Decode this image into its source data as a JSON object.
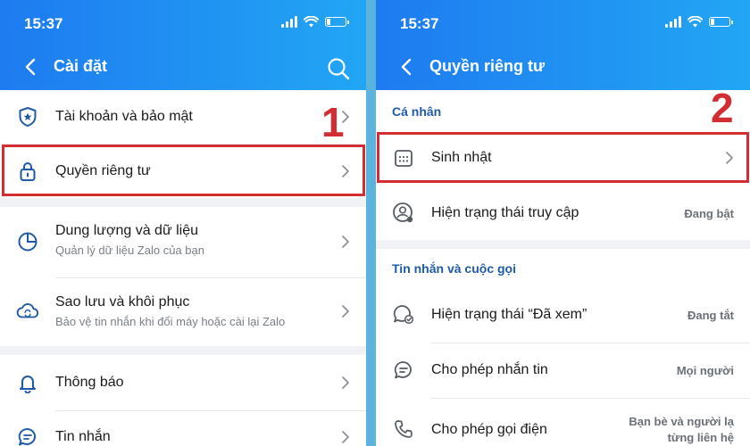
{
  "left": {
    "status": {
      "time": "15:37"
    },
    "header": {
      "title": "Cài đặt"
    },
    "items": [
      {
        "label": "Tài khoản và bảo mật"
      },
      {
        "label": "Quyền riêng tư"
      },
      {
        "label": "Dung lượng và dữ liệu",
        "sub": "Quản lý dữ liệu Zalo của bạn"
      },
      {
        "label": "Sao lưu và khôi phục",
        "sub": "Bảo vệ tin nhắn khi đổi máy hoặc cài lại Zalo"
      },
      {
        "label": "Thông báo"
      },
      {
        "label": "Tin nhắn"
      }
    ],
    "step": "1"
  },
  "right": {
    "status": {
      "time": "15:37"
    },
    "header": {
      "title": "Quyền riêng tư"
    },
    "sections": [
      "Cá nhân",
      "Tin nhắn và cuộc gọi"
    ],
    "items": [
      {
        "label": "Sinh nhật"
      },
      {
        "label": "Hiện trạng thái truy cập",
        "value": "Đang bật"
      },
      {
        "label": "Hiện trạng thái “Đã xem”",
        "value": "Đang tắt"
      },
      {
        "label": "Cho phép nhắn tin",
        "value": "Mọi người"
      },
      {
        "label": "Cho phép gọi điện",
        "value_line1": "Bạn bè và người lạ",
        "value_line2": "từng liên hệ"
      }
    ],
    "step": "2"
  },
  "colors": {
    "header_start": "#1e7bf0",
    "header_end": "#22a6f4",
    "highlight": "#d42c33",
    "section_title": "#1f5aa6",
    "icon": "#1f5aa6"
  }
}
